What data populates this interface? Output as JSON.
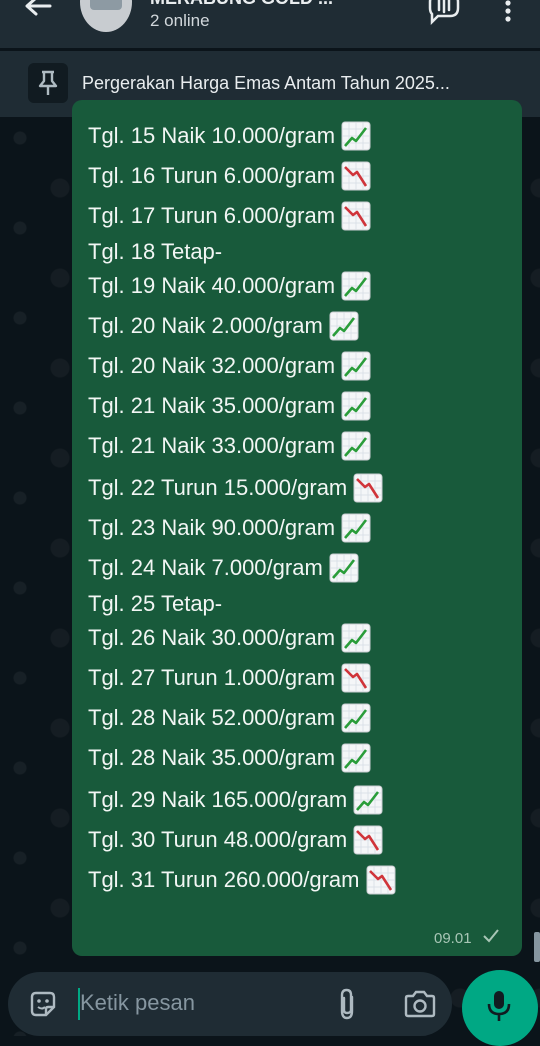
{
  "header": {
    "title": "MERABUNG GOLD ...",
    "subtitle": "2 online"
  },
  "pinned": {
    "text": "Pergerakan Harga Emas Antam Tahun 2025..."
  },
  "message": {
    "lines": [
      {
        "text": "Tgl. 15 Naik 10.000/gram",
        "trend": "up"
      },
      {
        "text": "Tgl. 16 Turun 6.000/gram",
        "trend": "down"
      },
      {
        "text": "Tgl. 17 Turun 6.000/gram",
        "trend": "down"
      },
      {
        "text": "Tgl. 18 Tetap-",
        "trend": "none"
      },
      {
        "text": "Tgl. 19 Naik 40.000/gram",
        "trend": "up"
      },
      {
        "text": "Tgl. 20 Naik 2.000/gram",
        "trend": "up"
      },
      {
        "text": "Tgl. 20 Naik 32.000/gram",
        "trend": "up"
      },
      {
        "text": "Tgl. 21 Naik 35.000/gram",
        "trend": "up"
      },
      {
        "text": "Tgl. 21 Naik 33.000/gram",
        "trend": "up"
      },
      {
        "text": "Tgl. 22 Turun 15.000/gram",
        "trend": "down"
      },
      {
        "text": "Tgl. 23 Naik 90.000/gram",
        "trend": "up"
      },
      {
        "text": "Tgl. 24 Naik 7.000/gram",
        "trend": "up"
      },
      {
        "text": "Tgl. 25 Tetap-",
        "trend": "none"
      },
      {
        "text": "Tgl. 26 Naik 30.000/gram",
        "trend": "up"
      },
      {
        "text": "Tgl. 27 Turun 1.000/gram",
        "trend": "down"
      },
      {
        "text": "Tgl. 28 Naik 52.000/gram",
        "trend": "up"
      },
      {
        "text": "Tgl. 28 Naik 35.000/gram",
        "trend": "up"
      },
      {
        "text": "Tgl. 29 Naik 165.000/gram",
        "trend": "up"
      },
      {
        "text": "Tgl. 30 Turun 48.000/gram",
        "trend": "down"
      },
      {
        "text": "Tgl. 31 Turun 260.000/gram",
        "trend": "down"
      }
    ],
    "time": "09.01",
    "status_icon": "single-check-icon"
  },
  "input": {
    "placeholder": "Ketik pesan"
  },
  "colors": {
    "bubble": "#185a3b",
    "accent": "#00a884",
    "up": "#2a9d3a",
    "down": "#d0343a"
  }
}
